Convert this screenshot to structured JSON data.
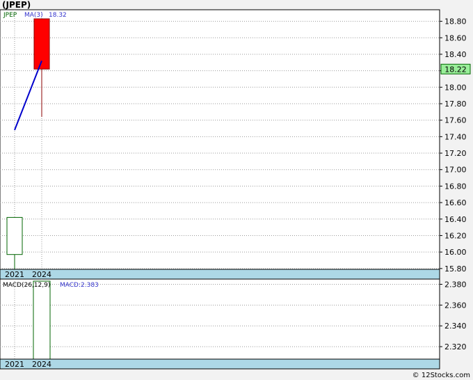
{
  "title": "(JPEP)",
  "footer": "© 12Stocks.com",
  "colors": {
    "up": "#006400",
    "down": "#ff0000",
    "ma": "#0000cc",
    "macd_label": "#3333cc",
    "strip": "#add8e6",
    "last_price_bg": "#99ee99"
  },
  "chart_data": [
    {
      "type": "candlestick",
      "legend": {
        "ticker": "JPEP",
        "ma_label": "MA(3)",
        "ma_value": "18.32"
      },
      "x_labels": [
        "2021",
        "2024"
      ],
      "y_ticks": [
        "15.80",
        "16.00",
        "16.20",
        "16.40",
        "16.60",
        "16.80",
        "17.00",
        "17.20",
        "17.40",
        "17.60",
        "17.80",
        "18.00",
        "18.20",
        "18.40",
        "18.60",
        "18.80"
      ],
      "ylim": [
        15.79,
        18.94
      ],
      "candles": [
        {
          "x": "2021",
          "open": 15.97,
          "high": 16.42,
          "low": 15.79,
          "close": 16.42
        },
        {
          "x": "2024",
          "open": 18.83,
          "high": 18.83,
          "low": 17.64,
          "close": 18.22
        }
      ],
      "ma": [
        {
          "x": "2021",
          "y": 17.48
        },
        {
          "x": "2024",
          "y": 18.32
        }
      ],
      "last_price": "18.22"
    },
    {
      "type": "bar",
      "legend": {
        "name": "MACD(26,12,9)",
        "value_label": "MACD:2.383"
      },
      "x_labels": [
        "2021",
        "2024"
      ],
      "y_ticks": [
        "2.320",
        "2.340",
        "2.360",
        "2.380"
      ],
      "ylim": [
        2.308,
        2.385
      ],
      "bars": [
        {
          "x": "2024",
          "value": 2.383
        }
      ]
    }
  ]
}
